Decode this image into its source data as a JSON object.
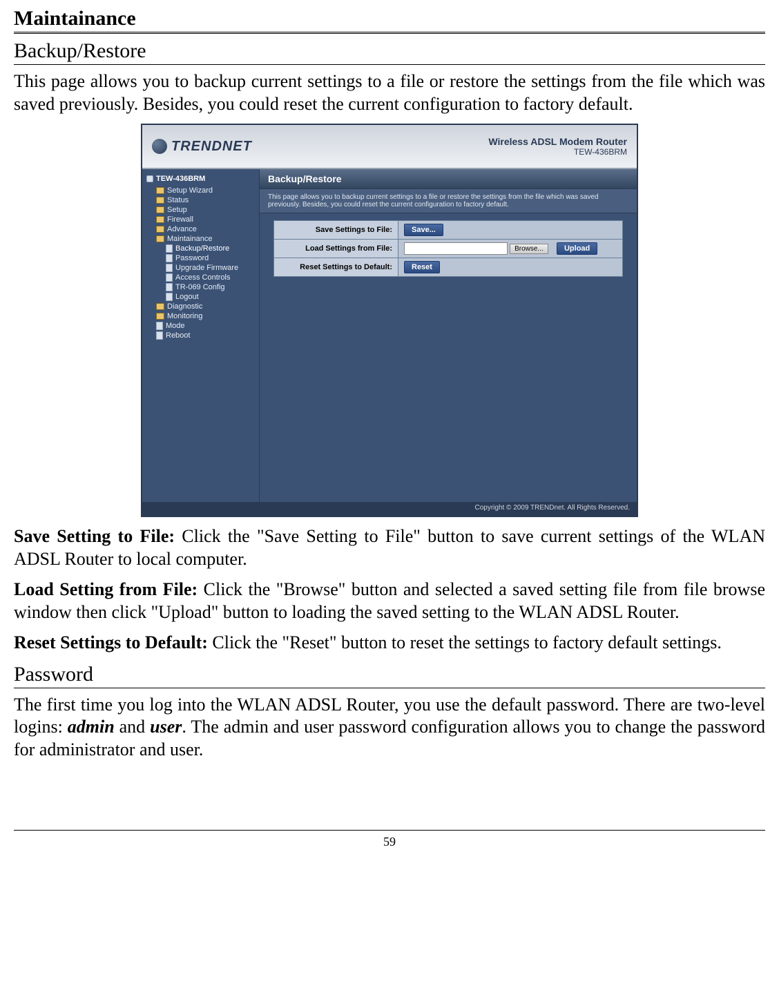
{
  "doc": {
    "title": "Maintainance",
    "section1_heading": "Backup/Restore",
    "intro": "This page allows you to backup current settings to a file or restore the settings from the file which was saved previously. Besides, you could reset the current configuration to factory default.",
    "save_label": "Save Setting to File:",
    "save_text": " Click the \"Save Setting to File\" button to save current settings of the WLAN ADSL Router to local computer.",
    "load_label": "Load Setting from File:",
    "load_text": " Click the \"Browse\" button and selected a saved setting file from file browse window then click \"Upload\" button to loading the saved setting to the WLAN ADSL Router.",
    "reset_label": "Reset Settings to Default:",
    "reset_text": " Click the \"Reset\" button to reset the settings to factory default settings.",
    "section2_heading": "Password",
    "password_text_1": "The first time you log into the WLAN ADSL Router, you use the default password. There are two-level logins: ",
    "password_admin": "admin",
    "password_and": " and ",
    "password_user": "user",
    "password_text_2": ". The admin and user password configuration allows you to change the password for administrator and user.",
    "page_number": "59"
  },
  "router": {
    "brand": "TRENDNET",
    "model_line1": "Wireless ADSL Modem Router",
    "model_line2": "TEW-436BRM",
    "tree_root": "TEW-436BRM",
    "nav": {
      "setup_wizard": "Setup Wizard",
      "status": "Status",
      "setup": "Setup",
      "firewall": "Firewall",
      "advance": "Advance",
      "maintainance": "Maintainance",
      "backup_restore": "Backup/Restore",
      "password": "Password",
      "upgrade_firmware": "Upgrade Firmware",
      "access_controls": "Access Controls",
      "tr069": "TR-069 Config",
      "logout": "Logout",
      "diagnostic": "Diagnostic",
      "monitoring": "Monitoring",
      "mode": "Mode",
      "reboot": "Reboot"
    },
    "panel": {
      "title": "Backup/Restore",
      "desc": "This page allows you to backup current settings to a file or restore the settings from the file which was saved previously. Besides, you could reset the current configuration to factory default.",
      "row1_label": "Save Settings to File:",
      "row1_btn": "Save...",
      "row2_label": "Load Settings from File:",
      "row2_browse": "Browse...",
      "row2_upload": "Upload",
      "row3_label": "Reset Settings to Default:",
      "row3_btn": "Reset"
    },
    "footer": "Copyright © 2009 TRENDnet. All Rights Reserved."
  }
}
